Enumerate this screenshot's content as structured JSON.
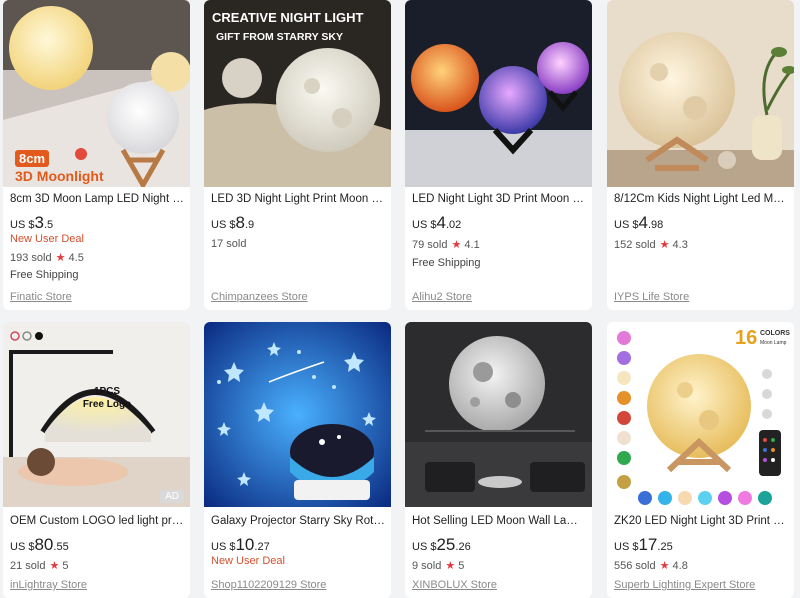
{
  "products": [
    {
      "title": "8cm 3D Moon Lamp LED Night Lig...",
      "currency": "US $",
      "price_int": "3",
      "price_dec": ".5",
      "deal": "New User Deal",
      "sold": "193 sold",
      "rating": "4.5",
      "shipping": "Free Shipping",
      "store": "Finatic Store",
      "overlay_badge": "8cm",
      "overlay_text": "3D Moonlight"
    },
    {
      "title": "LED 3D Night Light Print Moon La...",
      "currency": "US $",
      "price_int": "8",
      "price_dec": ".9",
      "sold": "17 sold",
      "store": "Chimpanzees Store",
      "overlay_line1": "CREATIVE NIGHT LIGHT",
      "overlay_line2": "GIFT FROM STARRY SKY"
    },
    {
      "title": "LED Night Light 3D Print Moon La...",
      "currency": "US $",
      "price_int": "4",
      "price_dec": ".02",
      "sold": "79 sold",
      "rating": "4.1",
      "shipping": "Free Shipping",
      "store": "Alihu2 Store"
    },
    {
      "title": "8/12Cm Kids Night Light Led Moon...",
      "currency": "US $",
      "price_int": "4",
      "price_dec": ".98",
      "sold": "152 sold",
      "rating": "4.3",
      "store": "IYPS Life Store"
    },
    {
      "title": "OEM Custom LOGO led light profe...",
      "currency": "US $",
      "price_int": "80",
      "price_dec": ".55",
      "sold": "21 sold",
      "rating": "5",
      "store": "inLightray Store",
      "ad_label": "AD",
      "overlay_line1": "1PCS",
      "overlay_line2": "Free Logo"
    },
    {
      "title": "Galaxy Projector Starry Sky Rotatin...",
      "currency": "US $",
      "price_int": "10",
      "price_dec": ".27",
      "deal": "New User Deal",
      "store": "Shop1102209129 Store"
    },
    {
      "title": "Hot Selling LED Moon Wall Lamp F...",
      "currency": "US $",
      "price_int": "25",
      "price_dec": ".26",
      "sold": "9 sold",
      "rating": "5",
      "store": "XINBOLUX Store"
    },
    {
      "title": "ZK20 LED Night Light 3D Print Moo...",
      "currency": "US $",
      "price_int": "17",
      "price_dec": ".25",
      "sold": "556 sold",
      "rating": "4.8",
      "store": "Superb Lighting Expert Store",
      "overlay_num": "16",
      "overlay_line1": "COLORS",
      "overlay_line2": "Moon Lamp"
    }
  ],
  "colors": {
    "deal": "#d4502f",
    "star": "#e4393c",
    "store": "#8a8a8a",
    "card_bg": "#ffffff",
    "page_bg": "#f2f3f5"
  },
  "icons": {
    "rating": "star-icon"
  }
}
